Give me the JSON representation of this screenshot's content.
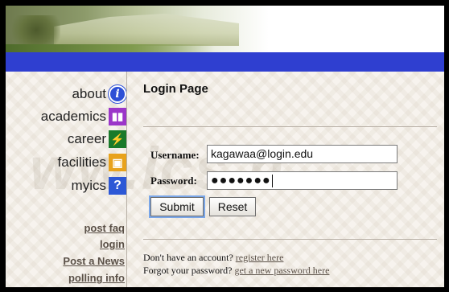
{
  "header": {
    "banner_alt": "campus banner"
  },
  "watermark": "ww.ics.h",
  "sidebar": {
    "items": [
      {
        "label": "about",
        "icon": "info-icon",
        "glyph": "i"
      },
      {
        "label": "academics",
        "icon": "book-icon",
        "glyph": "▮▮"
      },
      {
        "label": "career",
        "icon": "ladder-icon",
        "glyph": "⚡"
      },
      {
        "label": "facilities",
        "icon": "computer-icon",
        "glyph": "▣"
      },
      {
        "label": "myics",
        "icon": "person-icon",
        "glyph": "?"
      }
    ],
    "links": [
      "post faq",
      "login",
      "Post a News",
      "polling info"
    ]
  },
  "main": {
    "title": "Login Page",
    "username_label": "Username:",
    "username_value": "kagawaa@login.edu",
    "password_label": "Password:",
    "password_value": "●●●●●●●",
    "submit_label": "Submit",
    "reset_label": "Reset",
    "no_account_text": "Don't have an account?",
    "register_link": "register here",
    "forgot_text": "Forgot your password?",
    "new_password_link": "get a new password here"
  },
  "colors": {
    "blue_bar": "#2f3fd0",
    "border": "#000000"
  }
}
